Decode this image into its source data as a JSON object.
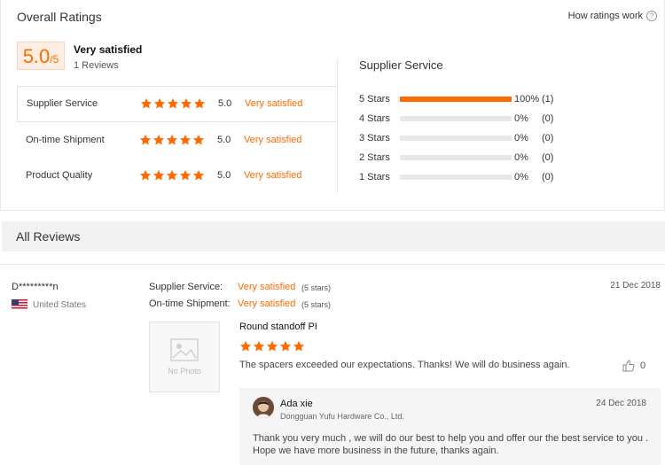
{
  "header": {
    "title": "Overall Ratings",
    "how_ratings_work": "How ratings work",
    "help_icon_glyph": "?"
  },
  "overall": {
    "score": "5.0",
    "score_suffix": "/5",
    "label": "Very satisfied",
    "reviews": "1 Reviews",
    "star_count": 5
  },
  "categories": [
    {
      "name": "Supplier Service",
      "score": "5.0",
      "text": "Very satisfied",
      "stars": 5
    },
    {
      "name": "On-time Shipment",
      "score": "5.0",
      "text": "Very satisfied",
      "stars": 5
    },
    {
      "name": "Product Quality",
      "score": "5.0",
      "text": "Very satisfied",
      "stars": 5
    }
  ],
  "distribution": {
    "title": "Supplier Service",
    "rows": [
      {
        "label": "5  Stars",
        "fraction": 1.0,
        "percent": "100%",
        "count": "(1)"
      },
      {
        "label": "4  Stars",
        "fraction": 0.0,
        "percent": "0%",
        "count": "(0)"
      },
      {
        "label": "3  Stars",
        "fraction": 0.0,
        "percent": "0%",
        "count": "(0)"
      },
      {
        "label": "2  Stars",
        "fraction": 0.0,
        "percent": "0%",
        "count": "(0)"
      },
      {
        "label": "1  Stars",
        "fraction": 0.0,
        "percent": "0%",
        "count": "(0)"
      }
    ]
  },
  "all_reviews": {
    "title": "All Reviews"
  },
  "review": {
    "user": "D*********n",
    "country": "United States",
    "date": "21 Dec 2018",
    "supplier_service_label": "Supplier Service:",
    "supplier_service_value": "Very satisfied",
    "supplier_service_stars": "(5 stars)",
    "shipment_label": "On-time Shipment:",
    "shipment_value": "Very satisfied",
    "shipment_stars": "(5 stars)",
    "photo_placeholder": "No Photo",
    "product_name": "Round standoff PI",
    "stars": 5,
    "text": "The spacers exceeded our expectations. Thanks! We will do business again.",
    "likes": "0"
  },
  "reply": {
    "name": "Ada xie",
    "company": "Dongguan Yufu Hardware Co., Ltd.",
    "date": "24 Dec 2018",
    "text": "Thank you very much , we will do our best to help you and offer our the best  service to you . Hope we have more business in the future, thanks again."
  },
  "colors": {
    "accent": "#ff6a00",
    "score_bg": "#fdeee3",
    "bar_empty": "#e8e8e8",
    "section_bg": "#f2f2f2"
  },
  "icons": {
    "star": "star-icon",
    "help": "help-icon",
    "thumb": "thumbs-up-icon",
    "flag": "us-flag-icon",
    "photo": "image-placeholder-icon"
  }
}
